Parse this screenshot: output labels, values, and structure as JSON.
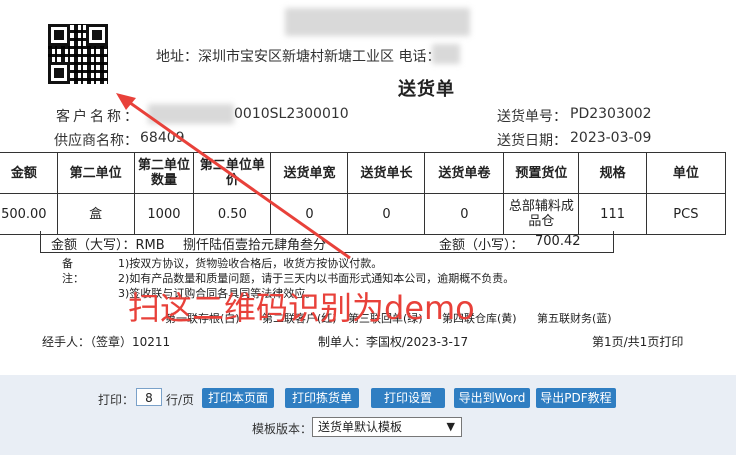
{
  "header": {
    "address": "地址：深圳市宝安区新塘村新塘工业区    电话：",
    "title": "送货单"
  },
  "meta": {
    "customer_label": "客户名称：",
    "customer_value": "0010SL2300010",
    "supplier_label": "供应商名称：",
    "supplier_value": "68409",
    "order_no_label": "送货单号：",
    "order_no_value": "PD2303002",
    "date_label": "送货日期：",
    "date_value": "2023-03-09"
  },
  "table": {
    "columns": [
      "金额",
      "第二单位",
      "第二单位数量",
      "第二单位单价",
      "送货单宽",
      "送货单长",
      "送货单卷",
      "预置货位",
      "规格",
      "单位"
    ],
    "rows": [
      [
        "500.00",
        "盒",
        "1000",
        "0.50",
        "0",
        "0",
        "0",
        "总部辅料成品仓",
        "111",
        "PCS"
      ]
    ]
  },
  "amount": {
    "upper_label": "金额（大写）：RMB",
    "upper_value": "捌仟陆佰壹拾元肆角叁分",
    "lower_label": "金额（小写）：",
    "lower_value": "700.42"
  },
  "remarks": {
    "label": "备注：",
    "lines": [
      "1)按双方协议，货物验收合格后，收货方按协议付款。",
      "2)如有产品数量和质量问题，请于三天内以书面形式通知本公司，逾期概不负责。",
      "3)签收联与订购合同各具同等法律效应。"
    ]
  },
  "copies": [
    "第一联存根(白)",
    "第二联客户(红)",
    "第三联回单(绿)",
    "第四联仓库(黄)",
    "第五联财务(蓝)"
  ],
  "footer": {
    "handler": "经手人：（签章）10211",
    "maker": "制单人：李国权/2023-3-17",
    "page": "第1页/共1页打印"
  },
  "annotation": "扫这二维码识别为demo",
  "toolbar": {
    "print_label": "打印：",
    "rows_value": "8",
    "rows_unit": "行/页",
    "btn_print_page": "打印本页面",
    "btn_print_pick": "打印拣货单",
    "btn_print_settings": "打印设置",
    "btn_export_word": "导出到Word",
    "btn_export_pdf": "导出PDF教程",
    "template_label": "模板版本：",
    "template_value": "送货单默认模板"
  },
  "colors": {
    "annotation": "#e8413a",
    "button": "#2f7ec2",
    "toolbar_bg": "#e9eef5"
  }
}
